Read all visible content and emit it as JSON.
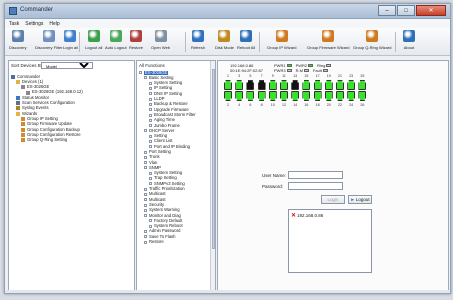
{
  "window": {
    "title": "Commander"
  },
  "menu": [
    "Task",
    "Settings",
    "Help"
  ],
  "toolbar": [
    {
      "label": "Discovery",
      "icon": "search-icon",
      "color": "#5a7fb0"
    },
    {
      "label": "Discovery Filter",
      "icon": "filter-icon",
      "color": "#7090c0"
    },
    {
      "label": "Login all",
      "icon": "user-icon",
      "color": "#3f7fd0"
    },
    {
      "label": "Logout all",
      "icon": "user-icon",
      "color": "#3aa04a"
    },
    {
      "label": "Auto Logout",
      "icon": "user-icon",
      "color": "#4aa85a"
    },
    {
      "label": "Restore",
      "icon": "restore-icon",
      "color": "#b04040"
    },
    {
      "label": "Open Web",
      "icon": "web-icon",
      "color": "#8090a0"
    },
    {
      "label": "Refresh",
      "icon": "refresh-icon",
      "color": "#3070c0"
    },
    {
      "label": "Disk Mode",
      "icon": "disk-icon",
      "color": "#c08a20"
    },
    {
      "label": "Reboot All",
      "icon": "reboot-icon",
      "color": "#2f6fb8"
    },
    {
      "label": "Group IP Wizard",
      "icon": "wizard-icon",
      "color": "#d07a20"
    },
    {
      "label": "Group Firmware Wizard",
      "icon": "wizard-icon",
      "color": "#d07a20"
    },
    {
      "label": "Group Q-Ring Wizard",
      "icon": "wizard-icon",
      "color": "#d07a20"
    },
    {
      "label": "About",
      "icon": "info-icon",
      "color": "#2f6fb8"
    }
  ],
  "left": {
    "sort_label": "Sort Devices By:",
    "sort_value": "Model",
    "tree": [
      {
        "label": "Commander",
        "level": 0,
        "icon": "computer-icon"
      },
      {
        "label": "Devices (1)",
        "level": 1,
        "icon": "folder-icon"
      },
      {
        "label": "ES-3026GE",
        "level": 2,
        "icon": "switch-icon"
      },
      {
        "label": "ES-3026GE (192.168.0.12)",
        "level": 3,
        "icon": "switch-icon"
      },
      {
        "label": "Status Monitor",
        "level": 1,
        "icon": "monitor-icon"
      },
      {
        "label": "Scan Services Configuration",
        "level": 1,
        "icon": "config-icon"
      },
      {
        "label": "Syslog Events",
        "level": 1,
        "icon": "log-icon"
      },
      {
        "label": "Wizards",
        "level": 1,
        "icon": "folder-icon"
      },
      {
        "label": "Group IP Setting",
        "level": 2,
        "icon": "wizard-icon"
      },
      {
        "label": "Group Firmware Update",
        "level": 2,
        "icon": "wizard-icon"
      },
      {
        "label": "Group Configuration Backup",
        "level": 2,
        "icon": "wizard-icon"
      },
      {
        "label": "Group Configuration Restore",
        "level": 2,
        "icon": "wizard-icon"
      },
      {
        "label": "Group Q-Ring Setting",
        "level": 2,
        "icon": "wizard-icon"
      }
    ]
  },
  "middle": {
    "title": "All Functions",
    "tree": [
      {
        "label": "ES-3026GE",
        "level": 0,
        "selected": true
      },
      {
        "label": "Basic Setting",
        "level": 1
      },
      {
        "label": "System Setting",
        "level": 2
      },
      {
        "label": "IP Setting",
        "level": 2
      },
      {
        "label": "DNS IP Setting",
        "level": 2
      },
      {
        "label": "LLDP",
        "level": 2
      },
      {
        "label": "Backup & Restore",
        "level": 2
      },
      {
        "label": "Upgrade Firmware",
        "level": 2
      },
      {
        "label": "Broadcast Storm Filter",
        "level": 2
      },
      {
        "label": "Aging Time",
        "level": 2
      },
      {
        "label": "Jumbo Frame",
        "level": 2
      },
      {
        "label": "DHCP Server",
        "level": 1
      },
      {
        "label": "Setting",
        "level": 2
      },
      {
        "label": "Client List",
        "level": 2
      },
      {
        "label": "Port and IP Binding",
        "level": 2
      },
      {
        "label": "Port Setting",
        "level": 1
      },
      {
        "label": "Trunk",
        "level": 1
      },
      {
        "label": "Vlan",
        "level": 1
      },
      {
        "label": "SNMP",
        "level": 1
      },
      {
        "label": "System Setting",
        "level": 2
      },
      {
        "label": "Trap Setting",
        "level": 2
      },
      {
        "label": "SNMPv3 Setting",
        "level": 2
      },
      {
        "label": "Traffic Prioritization",
        "level": 1
      },
      {
        "label": "Multicast",
        "level": 1
      },
      {
        "label": "Multicast",
        "level": 1
      },
      {
        "label": "Security",
        "level": 1
      },
      {
        "label": "System Warning",
        "level": 1
      },
      {
        "label": "Monitor and Diag",
        "level": 1
      },
      {
        "label": "Factory Default",
        "level": 2
      },
      {
        "label": "System Reboot",
        "level": 2
      },
      {
        "label": "Admin Password",
        "level": 1
      },
      {
        "label": "Save To Flash",
        "level": 1
      },
      {
        "label": "Restore",
        "level": 1
      }
    ]
  },
  "device": {
    "ip": "192.168.0.86",
    "mac": "00:1E:94:2F:02:87",
    "indicators_row1": [
      {
        "label": "PWR1",
        "color": "#22dd22"
      },
      {
        "label": "PWR2",
        "color": "#22dd22"
      },
      {
        "label": "Ring",
        "color": "#cccccc"
      }
    ],
    "indicators_row2": [
      {
        "label": "PWR3",
        "color": "#cccccc"
      },
      {
        "label": "R.M",
        "color": "#cccccc"
      },
      {
        "label": "Fault",
        "color": "#cccccc"
      }
    ],
    "top_port_numbers": [
      "1",
      "3",
      "5",
      "7",
      "9",
      "11",
      "13",
      "15",
      "17",
      "19",
      "21",
      "23",
      "25"
    ],
    "bottom_port_numbers": [
      "2",
      "4",
      "6",
      "8",
      "10",
      "12",
      "14",
      "16",
      "18",
      "20",
      "22",
      "24",
      "26"
    ],
    "top_port_states": [
      "up",
      "up",
      "down",
      "down",
      "up",
      "up",
      "down",
      "up",
      "up",
      "up",
      "up",
      "up",
      "up"
    ],
    "bottom_port_states": [
      "up",
      "up",
      "up",
      "up",
      "up",
      "up",
      "up",
      "up",
      "up",
      "up",
      "up",
      "up",
      "up"
    ],
    "port_up_color": "#39e22a",
    "port_down_color": "#121212"
  },
  "login": {
    "user_label": "User Name:",
    "user_value": "",
    "password_label": "Password:",
    "password_value": "",
    "login_label": "Login",
    "logout_label": "Logout",
    "devices": [
      "192.168.0.86"
    ]
  }
}
